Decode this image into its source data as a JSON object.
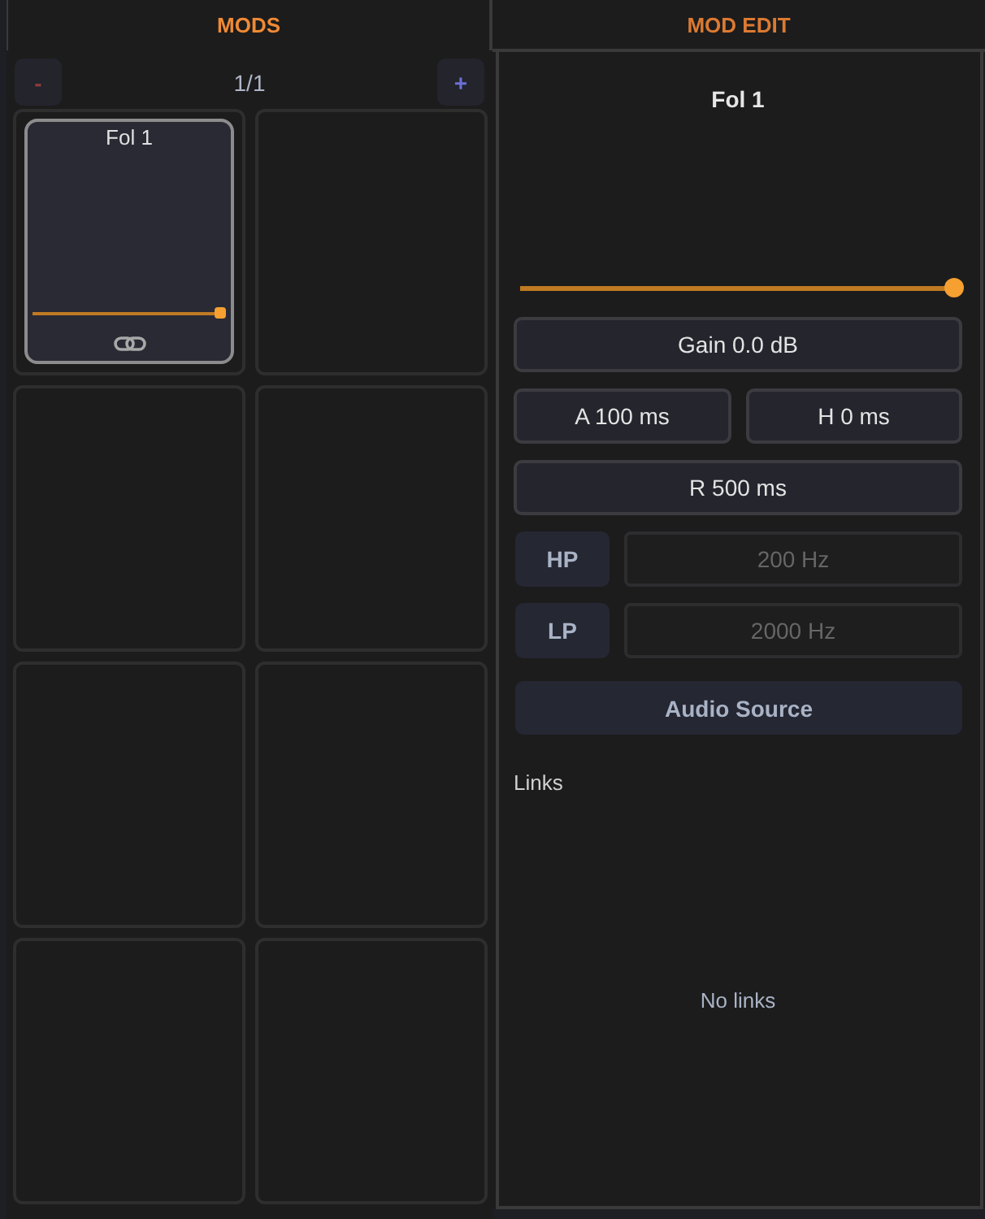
{
  "mods_panel": {
    "title": "MODS",
    "pager": {
      "prev_button": "-",
      "page": "1/1",
      "next_button": "+"
    },
    "slots": [
      {
        "kind": "mod",
        "name": "Fol 1",
        "selected": true,
        "level": 1
      },
      {
        "kind": "empty",
        "selected": false
      },
      {
        "kind": "empty",
        "selected": false
      },
      {
        "kind": "empty",
        "selected": false
      },
      {
        "kind": "empty",
        "selected": false
      },
      {
        "kind": "empty",
        "selected": false
      },
      {
        "kind": "empty",
        "selected": false
      },
      {
        "kind": "empty",
        "selected": false
      }
    ]
  },
  "mod_edit": {
    "title": "MOD EDIT",
    "mod_name": "Fol 1",
    "slider": {
      "level": 1
    },
    "param_rows": [
      {
        "buttons": [
          "Gain 0.0 dB"
        ]
      },
      {
        "buttons": [
          "A 100 ms",
          "H 0 ms"
        ]
      },
      {
        "buttons": [
          "R 500 ms"
        ]
      }
    ],
    "filters": [
      {
        "label": "HP",
        "enabled": false,
        "value": "200 Hz"
      },
      {
        "label": "LP",
        "enabled": false,
        "value": "2000 Hz"
      }
    ],
    "source_button": "Audio Source",
    "links": {
      "label": "Links",
      "empty_text": "No links"
    }
  }
}
